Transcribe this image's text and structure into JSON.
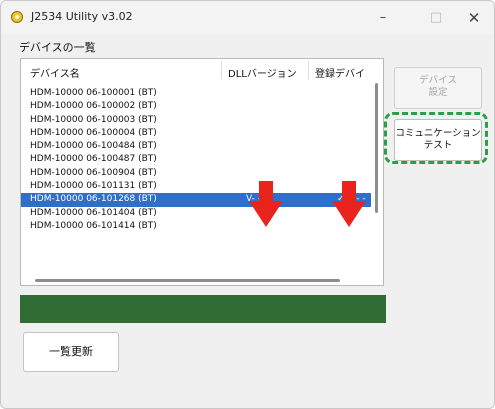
{
  "window": {
    "title": "J2534 Utility v3.02",
    "minimize": "–",
    "maximize": "□",
    "close": "✕",
    "app_icon": "app-gear-icon"
  },
  "section_label": "デバイスの一覧",
  "table": {
    "columns": [
      "デバイス名",
      "DLLバージョン",
      "登録デバイ"
    ],
    "rows": [
      {
        "name": "HDM-10000 06-100001 (BT)",
        "dll": "",
        "reg": ""
      },
      {
        "name": "HDM-10000 06-100002 (BT)",
        "dll": "",
        "reg": ""
      },
      {
        "name": "HDM-10000 06-100003 (BT)",
        "dll": "",
        "reg": ""
      },
      {
        "name": "HDM-10000 06-100004 (BT)",
        "dll": "",
        "reg": ""
      },
      {
        "name": "HDM-10000 06-100484 (BT)",
        "dll": "",
        "reg": ""
      },
      {
        "name": "HDM-10000 06-100487 (BT)",
        "dll": "",
        "reg": ""
      },
      {
        "name": "HDM-10000 06-100904 (BT)",
        "dll": "",
        "reg": ""
      },
      {
        "name": "HDM-10000 06-101131 (BT)",
        "dll": "",
        "reg": ""
      },
      {
        "name": "HDM-10000 06-101268 (BT)",
        "dll": "V- - -",
        "reg": "✓V- - -"
      },
      {
        "name": "HDM-10000 06-101404 (BT)",
        "dll": "",
        "reg": ""
      },
      {
        "name": "HDM-10000 06-101414 (BT)",
        "dll": "",
        "reg": ""
      }
    ],
    "selected_index": 8
  },
  "buttons": {
    "device_settings": [
      "デバイス",
      "設定"
    ],
    "comm_test": [
      "コミュニケーション",
      "テスト"
    ],
    "refresh": "一覧更新"
  },
  "colors": {
    "selection": "#2f6fc8",
    "status_bar": "#2f6d35",
    "highlight": "#2aa046",
    "arrow": "#e8241d"
  }
}
